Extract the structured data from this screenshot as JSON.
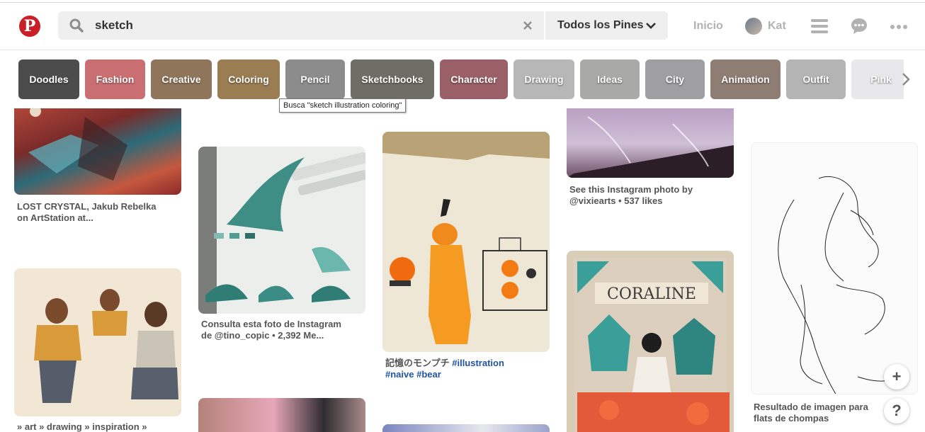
{
  "header": {
    "search_value": "sketch",
    "scope_label": "Todos los Pines",
    "nav_home": "Inicio",
    "user_name": "Kat",
    "brand_color": "#cb1f27",
    "icons": [
      "pinterest-logo-icon",
      "search-icon",
      "clear-icon",
      "chevron-down-icon",
      "menu-icon",
      "chat-icon",
      "more-icon"
    ]
  },
  "guides": [
    {
      "label": "Doodles",
      "color": "#4c4c4c"
    },
    {
      "label": "Fashion",
      "color": "#c96f72"
    },
    {
      "label": "Creative",
      "color": "#8f7559"
    },
    {
      "label": "Coloring",
      "color": "#9a7d52"
    },
    {
      "label": "Pencil",
      "color": "#8c8c8c"
    },
    {
      "label": "Sketchbooks",
      "color": "#6e6d66"
    },
    {
      "label": "Character",
      "color": "#9b5f67"
    },
    {
      "label": "Drawing",
      "color": "#b7b7b7"
    },
    {
      "label": "Ideas",
      "color": "#a9a9a7"
    },
    {
      "label": "City",
      "color": "#9e9ea3"
    },
    {
      "label": "Animation",
      "color": "#8e7d72"
    },
    {
      "label": "Outfit",
      "color": "#b4b4b4"
    },
    {
      "label": "Pink",
      "color": "#e8e8ec"
    }
  ],
  "tooltip": "Busca \"sketch illustration coloring\"",
  "pins": {
    "p1": {
      "desc": "LOST CRYSTAL, Jakub Rebelka on ArtStation at..."
    },
    "p2": {
      "desc": "» art » drawing » inspiration »"
    },
    "p3": {
      "desc": "Consulta esta foto de Instagram de @tino_copic • 2,392 Me..."
    },
    "p4": {
      "desc_text": "記憶のモンプチ ",
      "tag1": "#illustration",
      "tag2": "#naive #bear"
    },
    "p5": {
      "desc": "See this Instagram photo by @vixiearts • 537 likes"
    },
    "p6": {
      "desc": "Resultado de imagen para flats de chompas"
    }
  },
  "fab": {
    "add": "+",
    "help": "?"
  }
}
